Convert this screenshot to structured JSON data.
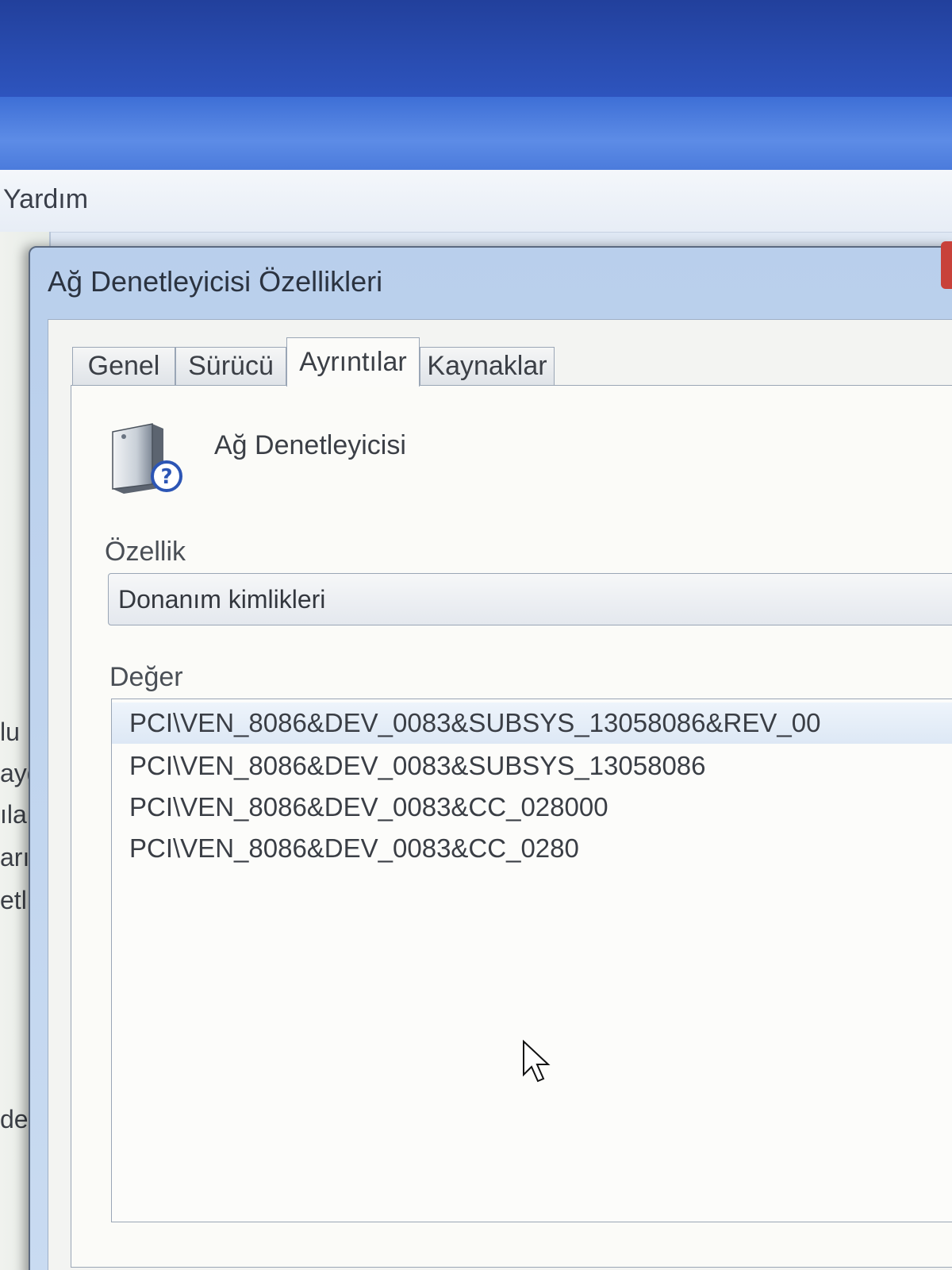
{
  "parent_window": {
    "menu_yardim": "Yardım",
    "side_fragments": [
      "lu",
      "ayg",
      "ıla",
      "arı",
      "etl",
      "den"
    ]
  },
  "dialog": {
    "title": "Ağ Denetleyicisi Özellikleri",
    "tabs": [
      {
        "label": "Genel",
        "active": false
      },
      {
        "label": "Sürücü",
        "active": false
      },
      {
        "label": "Ayrıntılar",
        "active": true
      },
      {
        "label": "Kaynaklar",
        "active": false
      }
    ],
    "device_name": "Ağ Denetleyicisi",
    "device_icon": "unknown-device-icon",
    "property_label": "Özellik",
    "property_value": "Donanım kimlikleri",
    "value_label": "Değer",
    "values": [
      "PCI\\VEN_8086&DEV_0083&SUBSYS_13058086&REV_00",
      "PCI\\VEN_8086&DEV_0083&SUBSYS_13058086",
      "PCI\\VEN_8086&DEV_0083&CC_028000",
      "PCI\\VEN_8086&DEV_0083&CC_0280"
    ]
  },
  "colors": {
    "desktop_blue": "#2a4fb0",
    "dialog_frame": "#b9cfec",
    "selected_row": "#dde8f5",
    "close_red": "#c8413a"
  }
}
